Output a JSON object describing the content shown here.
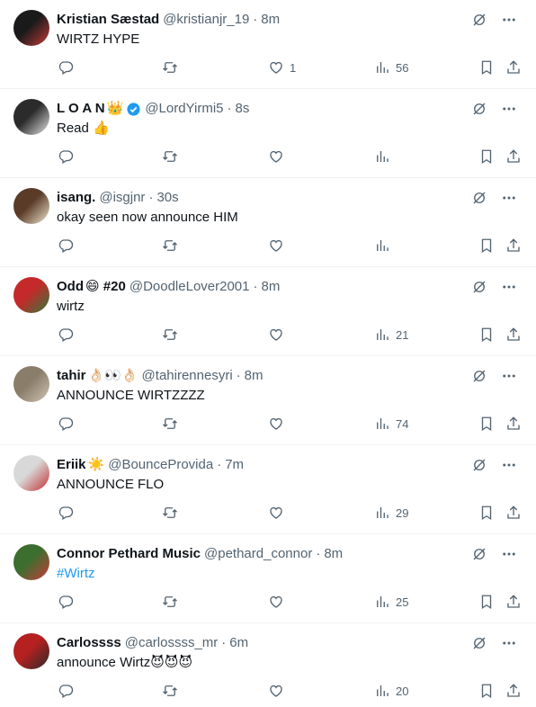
{
  "tweets": [
    {
      "name": "Kristian Sæstad",
      "name_emoji": "",
      "verified": false,
      "handle": "@kristianjr_19",
      "time": "8m",
      "text": "WIRTZ HYPE",
      "likes": "1",
      "views": "56",
      "avatar_colors": [
        "#1a1a1a",
        "#c63a3a"
      ]
    },
    {
      "name": "L O A N",
      "name_emoji": "👑",
      "verified": true,
      "handle": "@LordYirmi5",
      "time": "8s",
      "text": "Read 👍",
      "likes": "",
      "views": "",
      "avatar_colors": [
        "#2b2b2b",
        "#e6e6e6"
      ]
    },
    {
      "name": "isang.",
      "name_emoji": "",
      "verified": false,
      "handle": "@isgjnr",
      "time": "30s",
      "text": "okay seen now announce HIM",
      "likes": "",
      "views": "",
      "avatar_colors": [
        "#5a3b28",
        "#f0e6d0"
      ]
    },
    {
      "name": "Odd",
      "name_emoji": "😄 #20",
      "verified": false,
      "handle": "@DoodleLover2001",
      "time": "8m",
      "text": "wirtz",
      "likes": "",
      "views": "21",
      "avatar_colors": [
        "#c42a2a",
        "#2f7a3a"
      ]
    },
    {
      "name": "tahir",
      "name_emoji": "👌🏻👀👌🏻",
      "verified": false,
      "handle": "@tahirennesyri",
      "time": "8m",
      "text": "ANNOUNCE WIRTZZZZ",
      "likes": "",
      "views": "74",
      "avatar_colors": [
        "#8a7d6a",
        "#cfc5b3"
      ]
    },
    {
      "name": "Eriik",
      "name_emoji": "☀️",
      "verified": false,
      "handle": "@BounceProvida",
      "time": "7m",
      "text": "ANNOUNCE FLO",
      "likes": "",
      "views": "29",
      "avatar_colors": [
        "#d8d8d8",
        "#c32e2e"
      ]
    },
    {
      "name": "Connor Pethard Music",
      "name_emoji": "",
      "verified": false,
      "handle": "@pethard_connor",
      "time": "8m",
      "text": "#Wirtz",
      "likes": "",
      "views": "25",
      "avatar_colors": [
        "#3c6e2f",
        "#c93b3b"
      ]
    },
    {
      "name": "Carlossss",
      "name_emoji": "",
      "verified": false,
      "handle": "@carlossss_mr",
      "time": "6m",
      "text": "announce Wirtz😈😈😈",
      "likes": "",
      "views": "20",
      "avatar_colors": [
        "#b52020",
        "#2a2a2a"
      ]
    }
  ],
  "icons": {
    "grok": "grok-icon",
    "more": "more-icon",
    "reply": "reply-icon",
    "retweet": "retweet-icon",
    "like": "like-icon",
    "views": "views-icon",
    "bookmark": "bookmark-icon",
    "share": "share-icon"
  },
  "colors": {
    "text": "#0f1419",
    "muted": "#536471",
    "link": "#1d9bf0",
    "divider": "#eff3f4",
    "verified": "#1d9bf0",
    "crown": "#f4b400"
  }
}
